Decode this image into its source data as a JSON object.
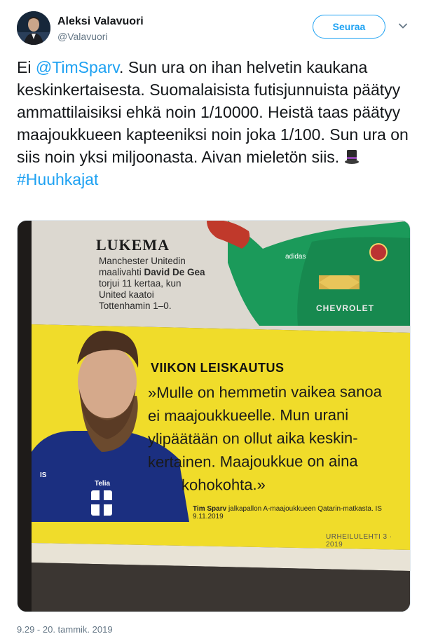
{
  "user": {
    "name": "Aleksi Valavuori",
    "handle": "@Valavuori",
    "follow_label": "Seuraa"
  },
  "tweet": {
    "text_part1": "Ei ",
    "mention": "@TimSparv",
    "text_part2": ". Sun ura on ihan helvetin kaukana keskinkertaisesta. Suomalaisista futisjunnuista päätyy ammattilaisiksi ehkä noin 1/10000. Heistä taas päätyy maajoukkueen kapteeniksi noin joka 1/100. Sun ura on siis noin yksi miljoonasta. Aivan mieletön siis. ",
    "emoji": "top-hat-icon",
    "hashtag": "#Huuhkajat",
    "timestamp": "9.29 - 20. tammik. 2019"
  },
  "photo": {
    "lukema_title": "LUKEMA",
    "lukema_line1": "Manchester Unitedin",
    "lukema_line2_a": "maalivahti ",
    "lukema_line2_b": "David De Gea",
    "lukema_line3": "torjui 11 kertaa, kun",
    "lukema_line4": "United kaatoi",
    "lukema_line5": "Tottenhamin 1–0.",
    "sponsor": "CHEVROLET",
    "kit_brand": "adidas",
    "vl_title": "VIIKON LEISKAUTUS",
    "vl_quote_1": "»Mulle on hemmetin vaikea sanoa",
    "vl_quote_2": "ei maajoukkueelle. Mun urani",
    "vl_quote_3": "ylipäätään on ollut aika keskin-",
    "vl_quote_4": "kertainen. Maajoukkue on aina",
    "vl_quote_5": "kohokohta.»",
    "vl_credit_name": "Tim Sparv",
    "vl_credit_rest": " jalkapallon A-maajoukkueen Qatarin-matkasta. IS 9.11.2019",
    "vl_footer": "URHEILULEHTI 3 · 2019",
    "jersey_brand": "Telia",
    "jersey_badge": "IS",
    "colors": {
      "yellow": "#f0dc2a",
      "green_kit": "#1b9a5a",
      "blue_kit": "#1b2f80",
      "twitter_blue": "#1da1f2"
    }
  }
}
